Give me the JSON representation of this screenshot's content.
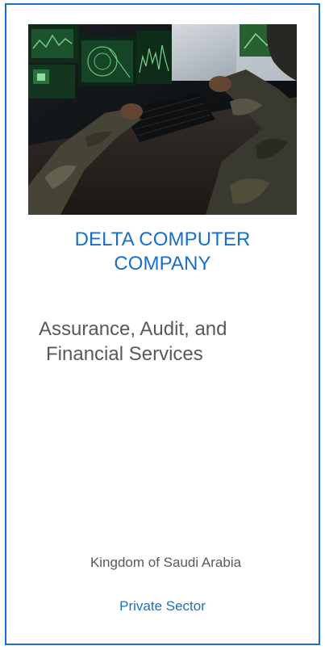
{
  "card": {
    "image": {
      "icon": "military-operator-at-computer-photo"
    },
    "company_name": {
      "line1": "DELTA COMPUTER",
      "line2": "COMPANY"
    },
    "services": {
      "line1": "Assurance, Audit, and",
      "line2": "Financial Services"
    },
    "country": "Kingdom of Saudi Arabia",
    "sector": "Private Sector"
  },
  "colors": {
    "accent": "#1a6fc4",
    "body_text": "#595959",
    "border": "#1a6fc4"
  }
}
